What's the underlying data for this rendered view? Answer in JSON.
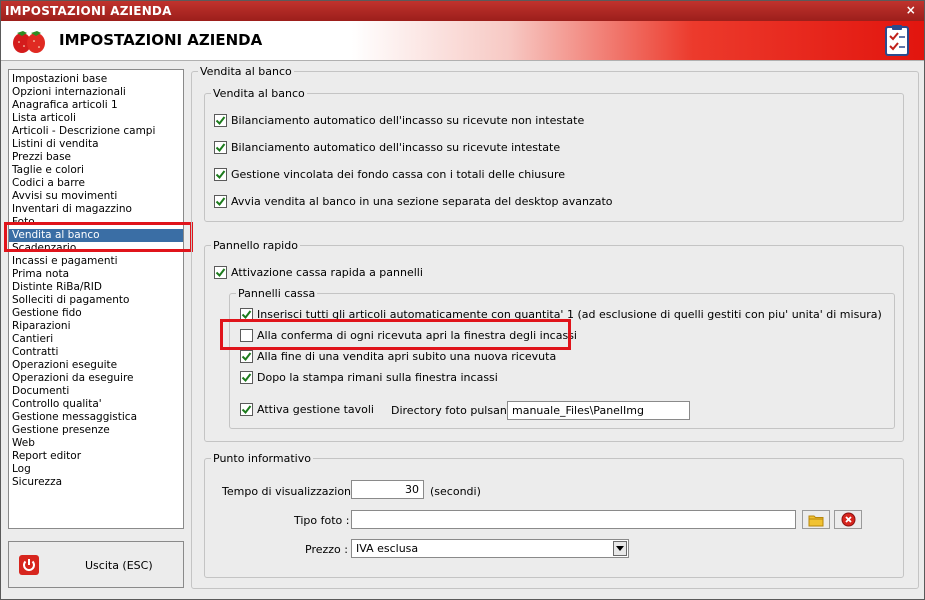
{
  "window": {
    "title": "IMPOSTAZIONI AZIENDA",
    "close_glyph": "×",
    "header_title": "IMPOSTAZIONI AZIENDA",
    "logo_icon": "strawberries-icon",
    "header_icon": "checklist-icon"
  },
  "sidebar": {
    "items": [
      "Impostazioni base",
      "Opzioni internazionali",
      "Anagrafica articoli 1",
      "Lista articoli",
      "Articoli - Descrizione campi",
      "Listini di vendita",
      "Prezzi base",
      "Taglie e colori",
      "Codici a barre",
      "Avvisi su movimenti",
      "Inventari di magazzino",
      "Foto",
      "Vendita al banco",
      "Scadenzario",
      "Incassi e pagamenti",
      "Prima nota",
      "Distinte RiBa/RID",
      "Solleciti di pagamento",
      "Gestione fido",
      "Riparazioni",
      "Cantieri",
      "Contratti",
      "Operazioni eseguite",
      "Operazioni da eseguire",
      "Documenti",
      "Controllo qualita'",
      "Gestione messaggistica",
      "Gestione presenze",
      "Web",
      "Report editor",
      "Log",
      "Sicurezza"
    ],
    "selected": "Vendita al banco"
  },
  "exit_button": {
    "label": "Uscita (ESC)",
    "icon": "power-icon"
  },
  "main": {
    "group_title": "Vendita al banco",
    "vendita": {
      "legend": "Vendita al banco",
      "options": [
        {
          "label": "Bilanciamento automatico dell'incasso su ricevute non intestate",
          "checked": true
        },
        {
          "label": "Bilanciamento automatico dell'incasso su ricevute intestate",
          "checked": true
        },
        {
          "label": "Gestione vincolata dei fondo cassa con i totali delle chiusure",
          "checked": true
        },
        {
          "label": "Avvia vendita al banco in una sezione separata del desktop avanzato",
          "checked": true
        }
      ]
    },
    "pannello": {
      "legend": "Pannello rapido",
      "attivazione": {
        "label": "Attivazione cassa rapida a pannelli",
        "checked": true
      },
      "pannelli_cassa": {
        "legend": "Pannelli cassa",
        "options": [
          {
            "label": "Inserisci tutti gli articoli automaticamente con quantita' 1 (ad esclusione di quelli gestiti con piu' unita' di misura)",
            "checked": true
          },
          {
            "label": "Alla conferma di ogni ricevuta apri la finestra degli incassi",
            "checked": false
          },
          {
            "label": "Alla fine di una vendita apri subito una nuova ricevuta",
            "checked": true
          },
          {
            "label": "Dopo la stampa rimani sulla finestra incassi",
            "checked": true
          }
        ],
        "tavoli": {
          "label": "Attiva gestione tavoli",
          "checked": true
        },
        "directory_label": "Directory foto pulsanti :",
        "directory_value": "manuale_Files\\PanelImg"
      }
    },
    "punto": {
      "legend": "Punto informativo",
      "tempo_label": "Tempo di visualizzazione :",
      "tempo_value": "30",
      "tempo_unit": "(secondi)",
      "tipo_foto_label": "Tipo foto :",
      "tipo_foto_value": "",
      "prezzo_label": "Prezzo :",
      "prezzo_value": "IVA esclusa"
    }
  },
  "colors": {
    "highlight": "#e0141b",
    "selection": "#3a6ea5",
    "title_bar": "#b02a25"
  }
}
